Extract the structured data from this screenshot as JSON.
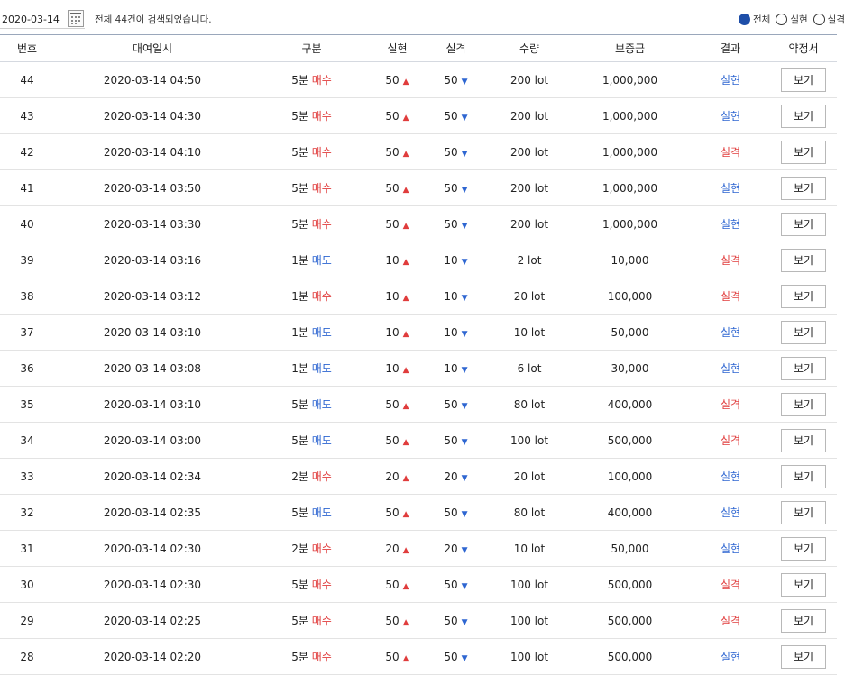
{
  "filter": {
    "date_value": "2020-03-14",
    "result_text": "전체 44건이 검색되었습니다.",
    "radios": [
      {
        "label": "전체",
        "selected": true
      },
      {
        "label": "실현",
        "selected": false
      },
      {
        "label": "실격",
        "selected": false
      }
    ]
  },
  "colors": {
    "accent": "#1e4ea8",
    "up": "#e03c3c",
    "down": "#2e66d1"
  },
  "table": {
    "headers": [
      "번호",
      "대여일시",
      "구분",
      "실현",
      "실격",
      "수량",
      "보증금",
      "결과",
      "약정서"
    ],
    "view_label": "보기",
    "rows": [
      {
        "no": "44",
        "datetime": "2020-03-14 04:50",
        "period": "5분",
        "side": "매수",
        "real": "50",
        "fail": "50",
        "qty": "200 lot",
        "deposit": "1,000,000",
        "result": "실현"
      },
      {
        "no": "43",
        "datetime": "2020-03-14 04:30",
        "period": "5분",
        "side": "매수",
        "real": "50",
        "fail": "50",
        "qty": "200 lot",
        "deposit": "1,000,000",
        "result": "실현"
      },
      {
        "no": "42",
        "datetime": "2020-03-14 04:10",
        "period": "5분",
        "side": "매수",
        "real": "50",
        "fail": "50",
        "qty": "200 lot",
        "deposit": "1,000,000",
        "result": "실격"
      },
      {
        "no": "41",
        "datetime": "2020-03-14 03:50",
        "period": "5분",
        "side": "매수",
        "real": "50",
        "fail": "50",
        "qty": "200 lot",
        "deposit": "1,000,000",
        "result": "실현"
      },
      {
        "no": "40",
        "datetime": "2020-03-14 03:30",
        "period": "5분",
        "side": "매수",
        "real": "50",
        "fail": "50",
        "qty": "200 lot",
        "deposit": "1,000,000",
        "result": "실현"
      },
      {
        "no": "39",
        "datetime": "2020-03-14 03:16",
        "period": "1분",
        "side": "매도",
        "real": "10",
        "fail": "10",
        "qty": "2 lot",
        "deposit": "10,000",
        "result": "실격"
      },
      {
        "no": "38",
        "datetime": "2020-03-14 03:12",
        "period": "1분",
        "side": "매수",
        "real": "10",
        "fail": "10",
        "qty": "20 lot",
        "deposit": "100,000",
        "result": "실격"
      },
      {
        "no": "37",
        "datetime": "2020-03-14 03:10",
        "period": "1분",
        "side": "매도",
        "real": "10",
        "fail": "10",
        "qty": "10 lot",
        "deposit": "50,000",
        "result": "실현"
      },
      {
        "no": "36",
        "datetime": "2020-03-14 03:08",
        "period": "1분",
        "side": "매도",
        "real": "10",
        "fail": "10",
        "qty": "6 lot",
        "deposit": "30,000",
        "result": "실현"
      },
      {
        "no": "35",
        "datetime": "2020-03-14 03:10",
        "period": "5분",
        "side": "매도",
        "real": "50",
        "fail": "50",
        "qty": "80 lot",
        "deposit": "400,000",
        "result": "실격"
      },
      {
        "no": "34",
        "datetime": "2020-03-14 03:00",
        "period": "5분",
        "side": "매도",
        "real": "50",
        "fail": "50",
        "qty": "100 lot",
        "deposit": "500,000",
        "result": "실격"
      },
      {
        "no": "33",
        "datetime": "2020-03-14 02:34",
        "period": "2분",
        "side": "매수",
        "real": "20",
        "fail": "20",
        "qty": "20 lot",
        "deposit": "100,000",
        "result": "실현"
      },
      {
        "no": "32",
        "datetime": "2020-03-14 02:35",
        "period": "5분",
        "side": "매도",
        "real": "50",
        "fail": "50",
        "qty": "80 lot",
        "deposit": "400,000",
        "result": "실현"
      },
      {
        "no": "31",
        "datetime": "2020-03-14 02:30",
        "period": "2분",
        "side": "매수",
        "real": "20",
        "fail": "20",
        "qty": "10 lot",
        "deposit": "50,000",
        "result": "실현"
      },
      {
        "no": "30",
        "datetime": "2020-03-14 02:30",
        "period": "5분",
        "side": "매수",
        "real": "50",
        "fail": "50",
        "qty": "100 lot",
        "deposit": "500,000",
        "result": "실격"
      },
      {
        "no": "29",
        "datetime": "2020-03-14 02:25",
        "period": "5분",
        "side": "매수",
        "real": "50",
        "fail": "50",
        "qty": "100 lot",
        "deposit": "500,000",
        "result": "실격"
      },
      {
        "no": "28",
        "datetime": "2020-03-14 02:20",
        "period": "5분",
        "side": "매수",
        "real": "50",
        "fail": "50",
        "qty": "100 lot",
        "deposit": "500,000",
        "result": "실현"
      }
    ]
  }
}
